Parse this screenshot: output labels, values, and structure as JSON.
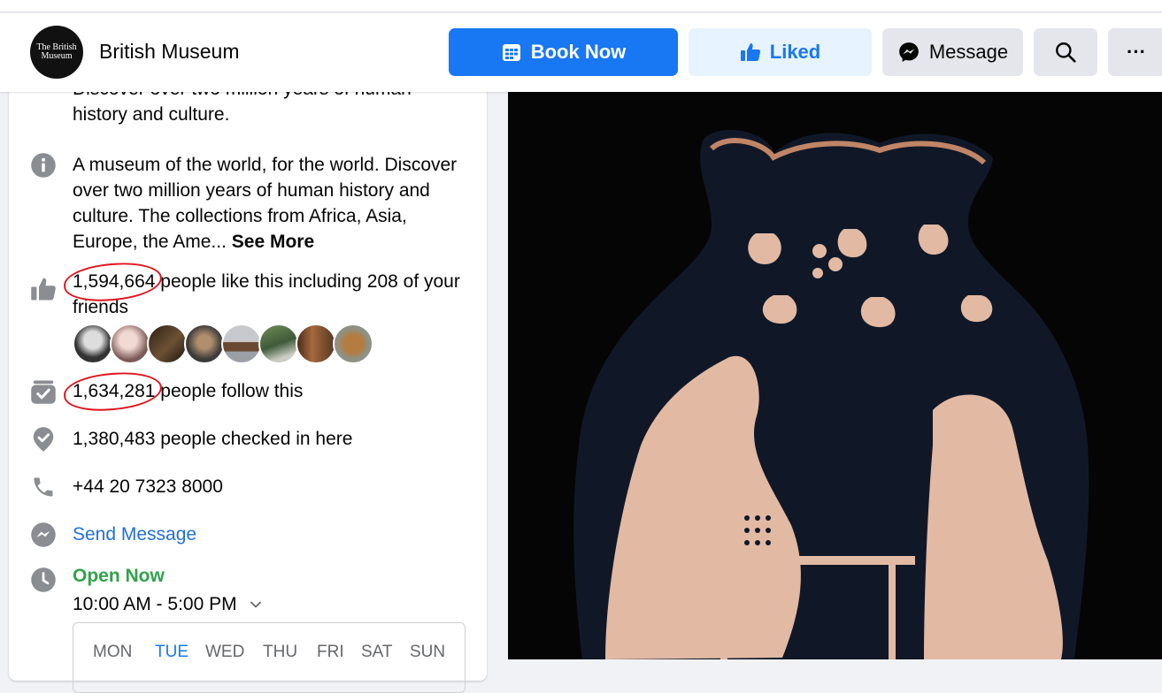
{
  "page": {
    "name": "British Museum",
    "logo_text_line1": "The British",
    "logo_text_line2": "Museum"
  },
  "header": {
    "book_label": "Book Now",
    "liked_label": "Liked",
    "message_label": "Message",
    "more_label": "···"
  },
  "about": {
    "short_desc_cut": "Discover over two million years of human",
    "short_desc_tail": "history and culture.",
    "long_desc": "A museum of the world, for the world. Discover over two million years of human history and culture. The collections from Africa, Asia, Europe, the Ame...",
    "see_more": "See More",
    "likes_count": "1,594,664",
    "likes_text": "people like this including 208 of your friends",
    "follows_count": "1,634,281",
    "follows_text": "people follow this",
    "checkins": "1,380,483 people checked in here",
    "phone": "+44 20 7323 8000",
    "send_message": "Send Message",
    "open_status": "Open Now",
    "hours": "10:00 AM - 5:00 PM",
    "days": [
      "MON",
      "TUE",
      "WED",
      "THU",
      "FRI",
      "SAT",
      "SUN"
    ],
    "active_day": "TUE"
  },
  "colors": {
    "accent": "#1877f2",
    "highlight": "#e0141d",
    "open_green": "#31a24c"
  }
}
